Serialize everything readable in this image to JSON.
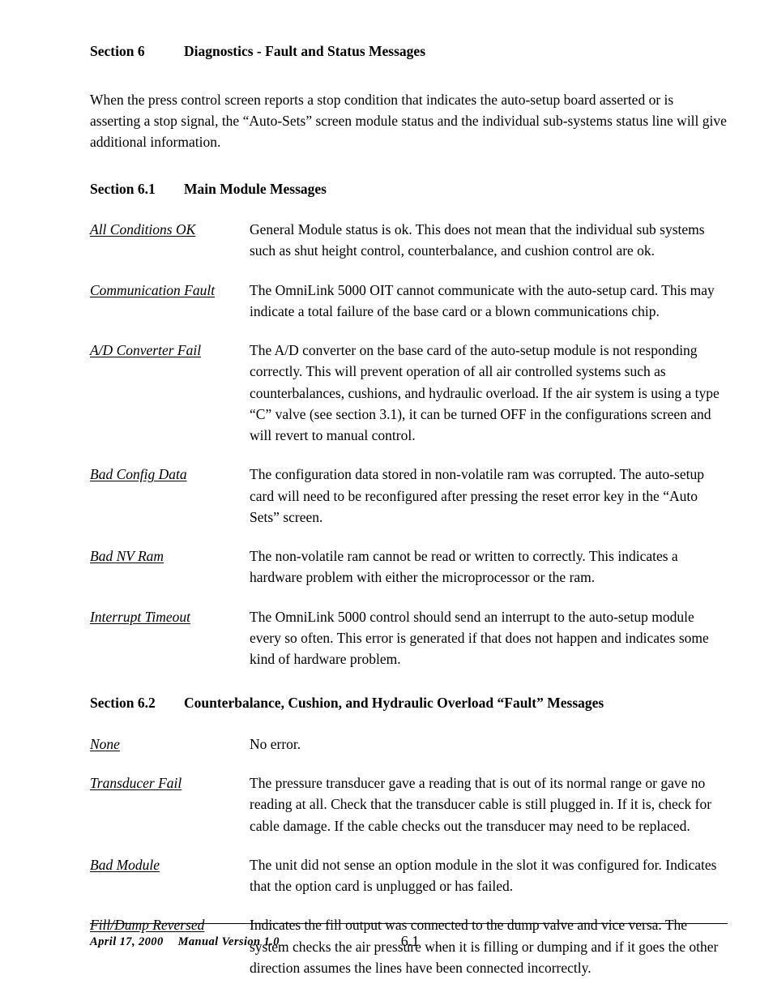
{
  "document": {
    "heading_main": {
      "number": "Section 6",
      "title": "Diagnostics - Fault and Status Messages"
    },
    "intro": "When the press control screen reports a stop condition that indicates the auto-setup board asserted or is asserting a stop signal, the “Auto-Sets” screen module status and the individual sub-systems status line will give additional information.",
    "section_61": {
      "number": "Section 6.1",
      "title": "Main Module Messages",
      "entries": [
        {
          "term": "All Conditions OK",
          "desc": "General Module status is ok.  This does not mean that the individual sub systems such as shut height control, counterbalance, and cushion control are ok."
        },
        {
          "term": "Communication Fault",
          "desc": "The OmniLink 5000 OIT cannot communicate with the auto-setup card.  This may indicate a total failure of the base card or a blown communications chip."
        },
        {
          "term": "A/D Converter Fail",
          "desc": "The A/D converter on the base card of the auto-setup module is not responding correctly.  This will prevent operation of all air controlled systems such as counterbalances, cushions, and hydraulic overload.  If the air system is using a type “C” valve (see section 3.1), it can be turned OFF in the configurations screen and will revert to manual control."
        },
        {
          "term": "Bad Config Data",
          "desc": "The configuration data stored in non-volatile ram was corrupted.  The auto-setup card will need to be reconfigured after pressing the reset error key in the “Auto Sets” screen."
        },
        {
          "term": "Bad NV Ram",
          "desc": "The non-volatile ram cannot be read or written to correctly.  This indicates a hardware problem with either the microprocessor or the ram."
        },
        {
          "term": "Interrupt Timeout",
          "desc": "The OmniLink 5000 control should send an interrupt to the auto-setup module every so often.  This error is generated if that does not happen and  indicates some kind of hardware problem."
        }
      ]
    },
    "section_62": {
      "number": "Section 6.2",
      "title": "Counterbalance, Cushion, and Hydraulic Overload “Fault” Messages",
      "entries": [
        {
          "term": "None",
          "desc": "No error."
        },
        {
          "term": "Transducer Fail",
          "desc": "The pressure transducer gave a reading that is out of its normal range or gave no reading at all.  Check that the transducer cable is still plugged in.  If it is, check for cable damage.  If the cable checks out the transducer may need to be replaced."
        },
        {
          "term": "Bad Module",
          "desc": "The unit did not sense an option  module in the slot it was configured for. Indicates that the option card is unplugged or has failed."
        },
        {
          "term": "Fill/Dump Reversed",
          "desc": "Indicates the fill output was connected to the dump valve and vice versa. The system checks the air pressure when it is filling or dumping and if it goes the other direction assumes the lines have been connected incorrectly."
        }
      ]
    },
    "footer": {
      "date": "April 17, 2000",
      "version": "Manual Version 1.0",
      "page_number": "6.1"
    }
  }
}
